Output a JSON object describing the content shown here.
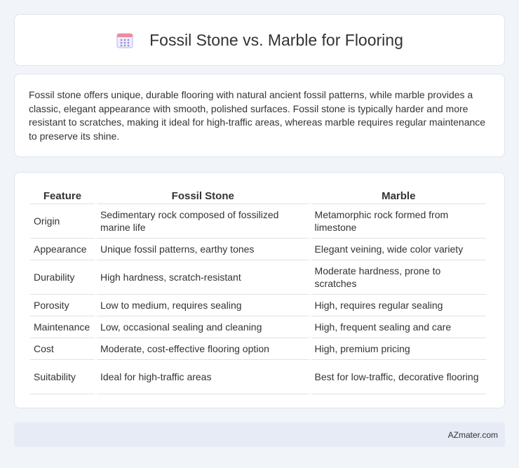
{
  "header": {
    "icon": "calendar-icon",
    "title": "Fossil Stone vs. Marble for Flooring"
  },
  "intro": {
    "text": "Fossil stone offers unique, durable flooring with natural ancient fossil patterns, while marble provides a classic, elegant appearance with smooth, polished surfaces. Fossil stone is typically harder and more resistant to scratches, making it ideal for high-traffic areas, whereas marble requires regular maintenance to preserve its shine."
  },
  "table": {
    "headers": [
      "Feature",
      "Fossil Stone",
      "Marble"
    ],
    "rows": [
      [
        "Origin",
        "Sedimentary rock composed of fossilized marine life",
        "Metamorphic rock formed from limestone"
      ],
      [
        "Appearance",
        "Unique fossil patterns, earthy tones",
        "Elegant veining, wide color variety"
      ],
      [
        "Durability",
        "High hardness, scratch-resistant",
        "Moderate hardness, prone to scratches"
      ],
      [
        "Porosity",
        "Low to medium, requires sealing",
        "High, requires regular sealing"
      ],
      [
        "Maintenance",
        "Low, occasional sealing and cleaning",
        "High, frequent sealing and care"
      ],
      [
        "Cost",
        "Moderate, cost-effective flooring option",
        "High, premium pricing"
      ],
      [
        "Suitability",
        "Ideal for high-traffic areas",
        "Best for low-traffic, decorative flooring"
      ]
    ]
  },
  "footer": {
    "text": "AZmater.com"
  },
  "colors": {
    "background": "#f1f4f9",
    "card": "#ffffff",
    "footer": "#e6ebf5",
    "icon_accent": "#8f7fe0"
  }
}
